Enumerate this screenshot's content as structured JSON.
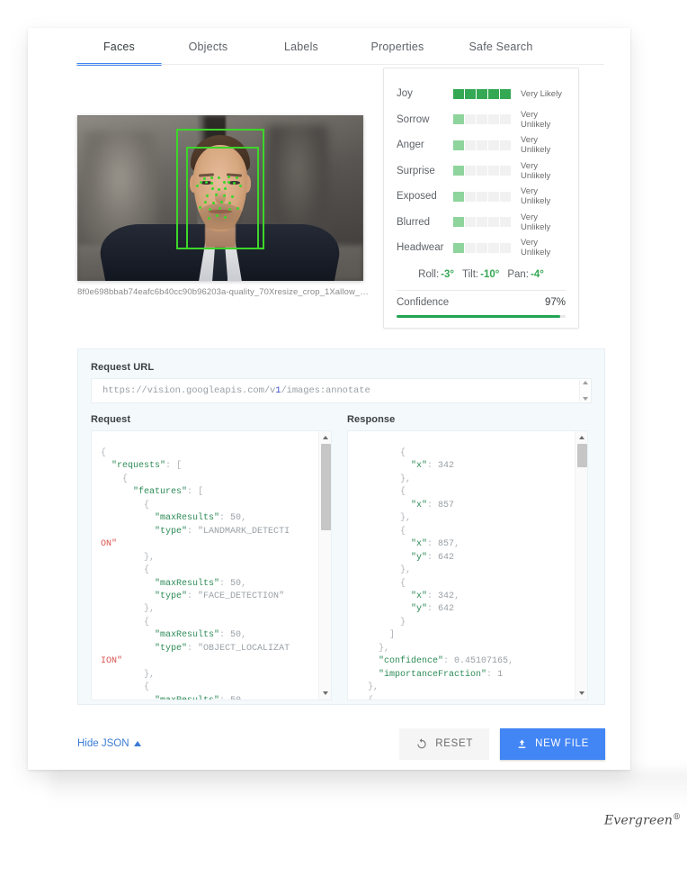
{
  "tabs": [
    {
      "label": "Faces",
      "active": true
    },
    {
      "label": "Objects",
      "active": false
    },
    {
      "label": "Labels",
      "active": false
    },
    {
      "label": "Properties",
      "active": false
    },
    {
      "label": "Safe Search",
      "active": false
    }
  ],
  "image": {
    "caption": "8f0e698bbab74eafc6b40cc90b96203a-quality_70Xresize_crop_1Xallow_enl…",
    "detection_boxes": 2,
    "landmark_color": "#3dd62a"
  },
  "face_attributes": {
    "rows": [
      {
        "name": "Joy",
        "likelihood": "Very Likely",
        "level": 5,
        "strong": true
      },
      {
        "name": "Sorrow",
        "likelihood": "Very Unlikely",
        "level": 1,
        "strong": false
      },
      {
        "name": "Anger",
        "likelihood": "Very Unlikely",
        "level": 1,
        "strong": false
      },
      {
        "name": "Surprise",
        "likelihood": "Very Unlikely",
        "level": 1,
        "strong": false
      },
      {
        "name": "Exposed",
        "likelihood": "Very Unlikely",
        "level": 1,
        "strong": false
      },
      {
        "name": "Blurred",
        "likelihood": "Very Unlikely",
        "level": 1,
        "strong": false
      },
      {
        "name": "Headwear",
        "likelihood": "Very Unlikely",
        "level": 1,
        "strong": false
      }
    ],
    "pose": {
      "roll_label": "Roll:",
      "roll_value": "-3°",
      "tilt_label": "Tilt:",
      "tilt_value": "-10°",
      "pan_label": "Pan:",
      "pan_value": "-4°"
    },
    "confidence": {
      "label": "Confidence",
      "value_text": "97%",
      "percent": 97
    },
    "colors": {
      "meter_strong": "#34a853",
      "meter_weak": "#8ed49c",
      "meter_off": "#f1f1f1",
      "accent_green": "#23a455"
    }
  },
  "json_area": {
    "request_url_label": "Request URL",
    "request_url_prefix": "https://vision.googleapis.com/v",
    "request_url_version": "1",
    "request_url_suffix": "/images:annotate",
    "request_label": "Request",
    "response_label": "Response",
    "request_body": "{\n  \"requests\": [\n    {\n      \"features\": [\n        {\n          \"maxResults\": 50,\n          \"type\": \"LANDMARK_DETECTI\nON\"\n        },\n        {\n          \"maxResults\": 50,\n          \"type\": \"FACE_DETECTION\"\n        },\n        {\n          \"maxResults\": 50,\n          \"type\": \"OBJECT_LOCALIZAT\nION\"\n        },\n        {\n          \"maxResults\": 50,\n          \"type\": \"LOGO_DETECTION\"\n        },",
    "response_body": "        {\n          \"x\": 342\n        },\n        {\n          \"x\": 857\n        },\n        {\n          \"x\": 857,\n          \"y\": 642\n        },\n        {\n          \"x\": 342,\n          \"y\": 642\n        }\n      ]\n    },\n    \"confidence\": 0.45107165,\n    \"importanceFraction\": 1\n  },\n  {\n    \"boundingPoly\": {\n      \"vertices\": ["
  },
  "footer": {
    "hide_json_label": "Hide JSON",
    "hide_json_icon": "chevron-up-icon",
    "reset_label": "RESET",
    "reset_icon": "refresh-icon",
    "new_file_label": "NEW FILE",
    "new_file_icon": "upload-icon",
    "new_file_color": "#4285f4"
  },
  "watermark": {
    "text": "Evergreen",
    "mark": "®"
  }
}
